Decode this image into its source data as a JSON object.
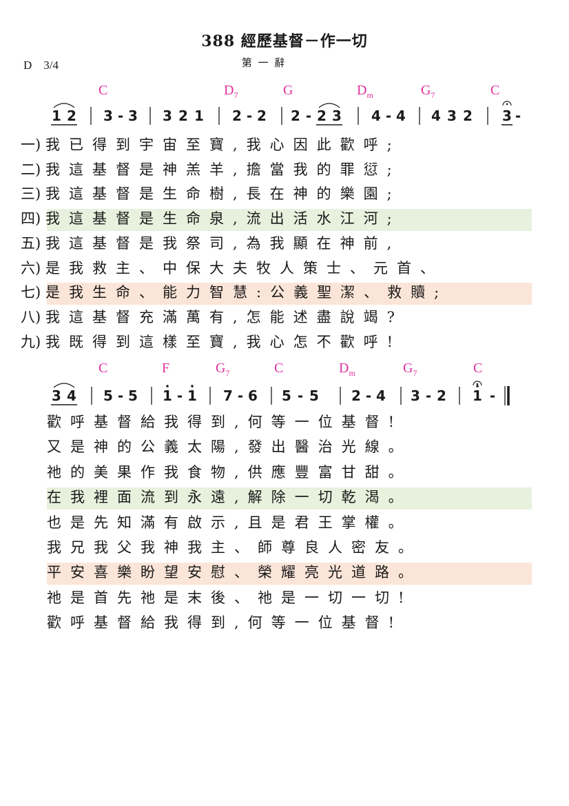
{
  "title": "388 經歷基督－作一切",
  "key": "D　3/4",
  "stanza_label": "第 一 辭",
  "colors": {
    "chord": "#e0309c",
    "highlight_green": "#e8f1dd",
    "highlight_peach": "#fbe5d8"
  },
  "section1": {
    "chords": [
      {
        "root": "C",
        "sub": ""
      },
      {
        "root": "D",
        "sub": "7"
      },
      {
        "root": "G",
        "sub": ""
      },
      {
        "root": "D",
        "sub": "m"
      },
      {
        "root": "G",
        "sub": "7"
      },
      {
        "root": "C",
        "sub": ""
      }
    ],
    "notation": {
      "measures": [
        {
          "notes": [
            {
              "t": "1",
              "ul": true
            },
            {
              "t": "2",
              "ul": true
            }
          ]
        },
        {
          "notes": [
            {
              "t": "3"
            },
            {
              "t": "-"
            },
            {
              "t": "3"
            }
          ]
        },
        {
          "notes": [
            {
              "t": "3"
            },
            {
              "t": "2"
            },
            {
              "t": "1"
            }
          ]
        },
        {
          "notes": [
            {
              "t": "2"
            },
            {
              "t": "-"
            },
            {
              "t": "2"
            }
          ]
        },
        {
          "notes": [
            {
              "t": "2"
            },
            {
              "t": "-"
            },
            {
              "t": "2",
              "ul": true
            },
            {
              "t": "3",
              "ul": true
            }
          ]
        },
        {
          "notes": [
            {
              "t": "4"
            },
            {
              "t": "-"
            },
            {
              "t": "4"
            }
          ]
        },
        {
          "notes": [
            {
              "t": "4"
            },
            {
              "t": "3"
            },
            {
              "t": "2"
            }
          ]
        },
        {
          "notes": [
            {
              "t": "3",
              "ul": true,
              "fermata": true
            },
            {
              "t": "-"
            }
          ]
        }
      ]
    },
    "verses": [
      {
        "label": "一)",
        "lyrics": "我已得到宇宙至寶,我心因此歡呼;"
      },
      {
        "label": "二)",
        "lyrics": "我這基督是神羔羊,擔當我的罪愆;"
      },
      {
        "label": "三)",
        "lyrics": "我這基督是生命樹,長在神的樂園;"
      },
      {
        "label": "四)",
        "lyrics": "我這基督是生命泉,流出活水江河;",
        "highlight": "green"
      },
      {
        "label": "五)",
        "lyrics": "我這基督是我祭司,為我顯在神前,"
      },
      {
        "label": "六)",
        "lyrics": "是我救主、中保大夫牧人策士、元首、"
      },
      {
        "label": "七)",
        "lyrics": "是我生命、能力智慧:公義聖潔、救贖;",
        "highlight": "peach"
      },
      {
        "label": "八)",
        "lyrics": "我這基督充滿萬有,怎能述盡說竭?"
      },
      {
        "label": "九)",
        "lyrics": "我既得到這樣至寶,我心怎不歡呼!"
      }
    ]
  },
  "section2": {
    "chords": [
      {
        "root": "C",
        "sub": ""
      },
      {
        "root": "F",
        "sub": ""
      },
      {
        "root": "G",
        "sub": "7"
      },
      {
        "root": "C",
        "sub": ""
      },
      {
        "root": "D",
        "sub": "m"
      },
      {
        "root": "G",
        "sub": "7"
      },
      {
        "root": "C",
        "sub": ""
      }
    ],
    "notation": {
      "measures": [
        {
          "notes": [
            {
              "t": "3",
              "ul": true
            },
            {
              "t": "4",
              "ul": true
            }
          ]
        },
        {
          "notes": [
            {
              "t": "5"
            },
            {
              "t": "-"
            },
            {
              "t": "5"
            }
          ]
        },
        {
          "notes": [
            {
              "t": "1",
              "dot": true
            },
            {
              "t": "-"
            },
            {
              "t": "1",
              "dot": true
            }
          ]
        },
        {
          "notes": [
            {
              "t": "7"
            },
            {
              "t": "-"
            },
            {
              "t": "6"
            }
          ]
        },
        {
          "notes": [
            {
              "t": "5"
            },
            {
              "t": "-"
            },
            {
              "t": "5"
            }
          ]
        },
        {
          "notes": [
            {
              "t": "2"
            },
            {
              "t": "-"
            },
            {
              "t": "4"
            }
          ]
        },
        {
          "notes": [
            {
              "t": "3"
            },
            {
              "t": "-"
            },
            {
              "t": "2"
            }
          ]
        },
        {
          "notes": [
            {
              "t": "1",
              "dot": true,
              "fermata": true
            },
            {
              "t": "-"
            }
          ]
        }
      ]
    },
    "verses": [
      {
        "lyrics": "歡呼基督給我得到,何等一位基督!"
      },
      {
        "lyrics": "又是神的公義太陽,發出醫治光線。"
      },
      {
        "lyrics": "祂的美果作我食物,供應豐富甘甜。"
      },
      {
        "lyrics": "在我裡面流到永遠,解除一切乾渴。",
        "highlight": "green"
      },
      {
        "lyrics": "也是先知滿有啟示,且是君王掌權。"
      },
      {
        "lyrics": "我兄我父我神我主、師尊良人密友。"
      },
      {
        "lyrics": "平安喜樂盼望安慰、榮耀亮光道路。",
        "highlight": "peach"
      },
      {
        "lyrics": "祂是首先祂是末後、祂是一切一切!"
      },
      {
        "lyrics": "歡呼基督給我得到,何等一位基督!"
      }
    ]
  }
}
